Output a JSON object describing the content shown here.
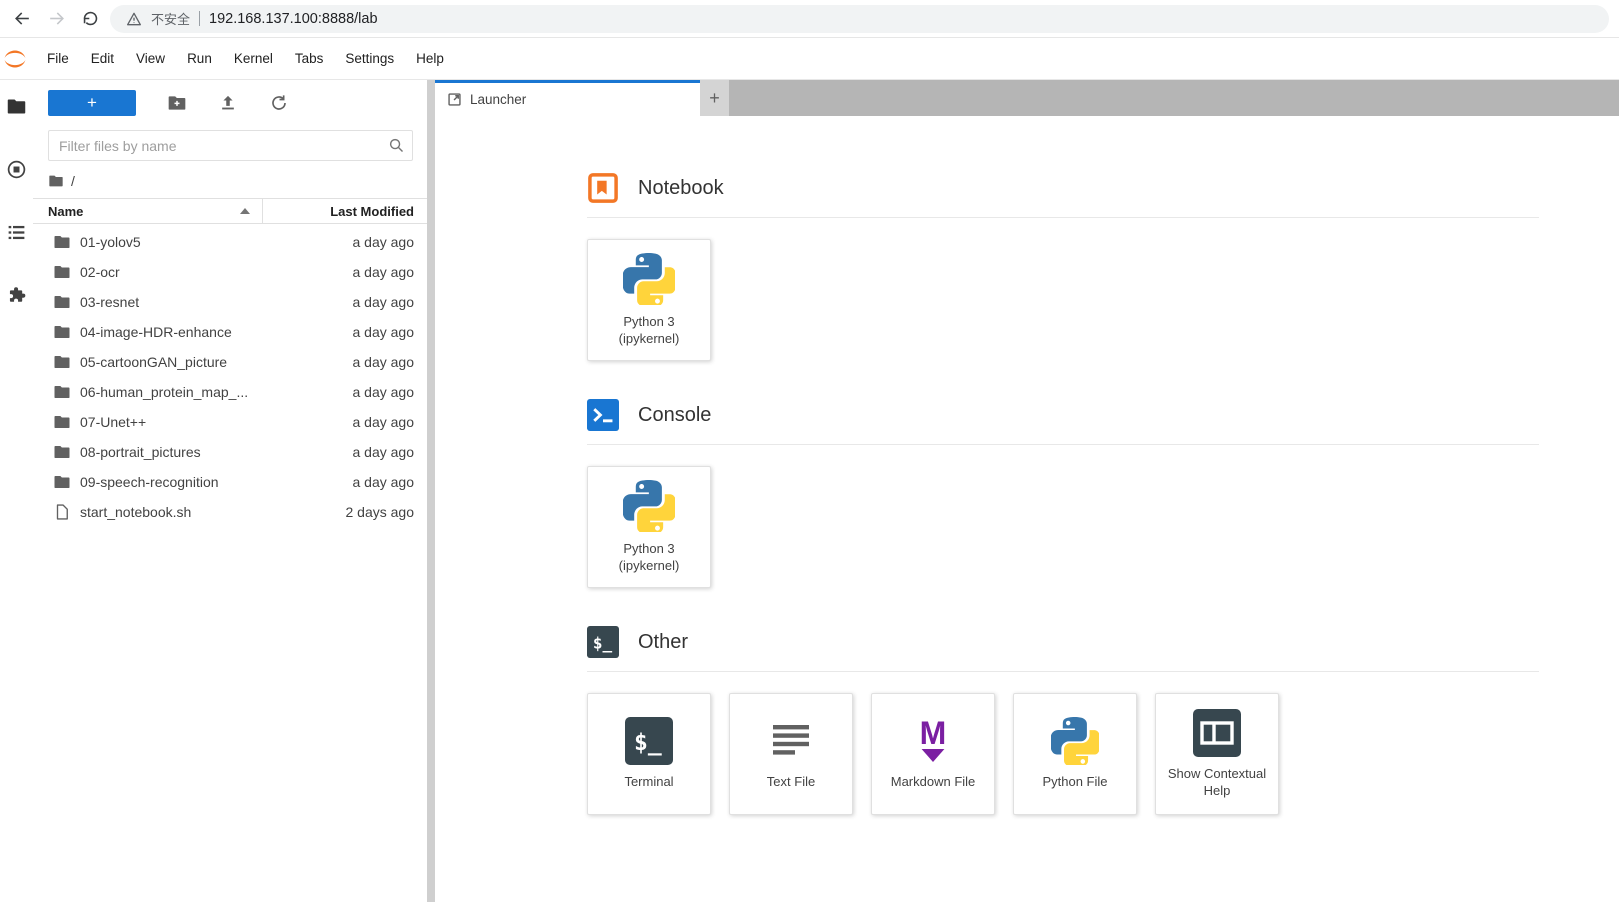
{
  "browser": {
    "security_label": "不安全",
    "url": "192.168.137.100:8888/lab"
  },
  "menubar": {
    "items": [
      "File",
      "Edit",
      "View",
      "Run",
      "Kernel",
      "Tabs",
      "Settings",
      "Help"
    ]
  },
  "filebrowser": {
    "new_launcher_button": "+",
    "filter_placeholder": "Filter files by name",
    "breadcrumb_root": "/",
    "columns": {
      "name": "Name",
      "modified": "Last Modified"
    },
    "items": [
      {
        "name": "01-yolov5",
        "modified": "a day ago",
        "type": "folder"
      },
      {
        "name": "02-ocr",
        "modified": "a day ago",
        "type": "folder"
      },
      {
        "name": "03-resnet",
        "modified": "a day ago",
        "type": "folder"
      },
      {
        "name": "04-image-HDR-enhance",
        "modified": "a day ago",
        "type": "folder"
      },
      {
        "name": "05-cartoonGAN_picture",
        "modified": "a day ago",
        "type": "folder"
      },
      {
        "name": "06-human_protein_map_...",
        "modified": "a day ago",
        "type": "folder"
      },
      {
        "name": "07-Unet++",
        "modified": "a day ago",
        "type": "folder"
      },
      {
        "name": "08-portrait_pictures",
        "modified": "a day ago",
        "type": "folder"
      },
      {
        "name": "09-speech-recognition",
        "modified": "a day ago",
        "type": "folder"
      },
      {
        "name": "start_notebook.sh",
        "modified": "2 days ago",
        "type": "file"
      }
    ]
  },
  "tabbar": {
    "launcher_tab": "Launcher",
    "new_tab_button": "+"
  },
  "launcher": {
    "notebook_section": {
      "title": "Notebook"
    },
    "console_section": {
      "title": "Console"
    },
    "other_section": {
      "title": "Other"
    },
    "cards": {
      "notebook_python": {
        "title": "Python 3",
        "subtitle": "(ipykernel)"
      },
      "console_python": {
        "title": "Python 3",
        "subtitle": "(ipykernel)"
      },
      "terminal": {
        "title": "Terminal"
      },
      "text_file": {
        "title": "Text File"
      },
      "markdown_file": {
        "title": "Markdown File"
      },
      "python_file": {
        "title": "Python File"
      },
      "contextual_help": {
        "title": "Show Contextual Help"
      }
    }
  },
  "colors": {
    "accent_blue": "#1976d2",
    "jupyter_orange": "#f37726",
    "markdown_purple": "#7b1fa2",
    "terminal_dark": "#37474f",
    "python_blue": "#3776ab",
    "python_yellow": "#ffd43b"
  }
}
